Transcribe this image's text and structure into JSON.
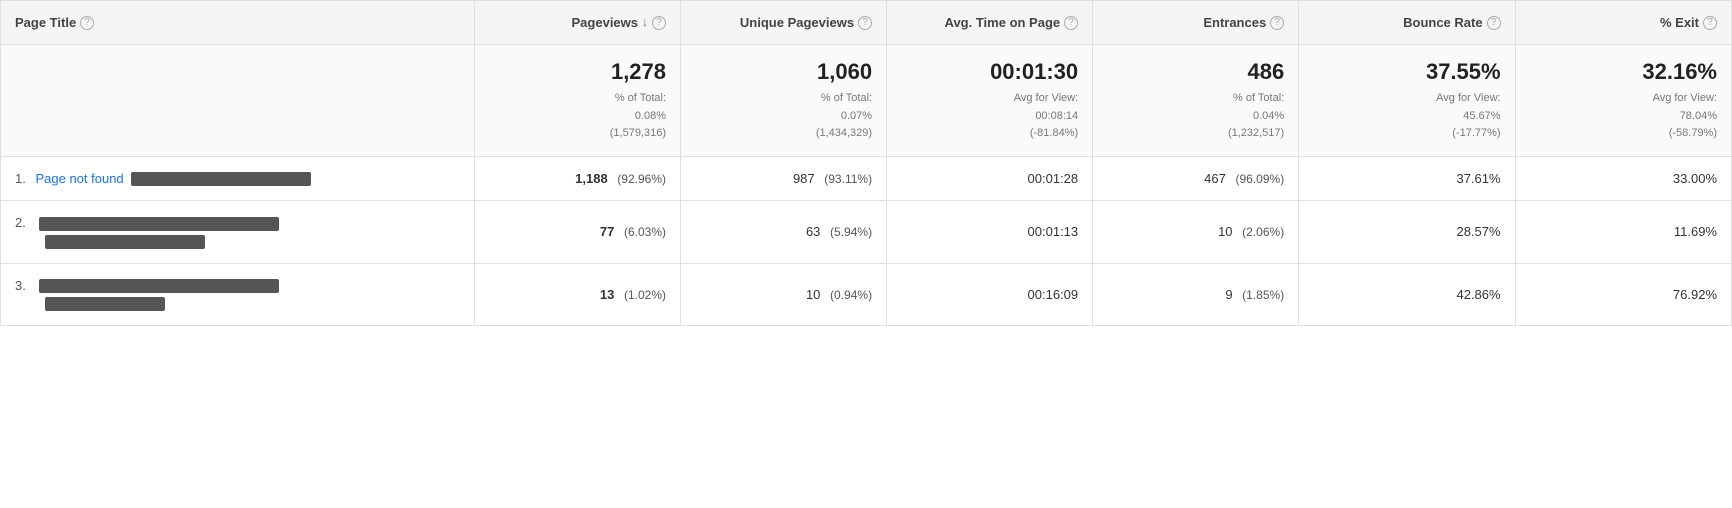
{
  "header": {
    "page_title_label": "Page Title",
    "pageviews_label": "Pageviews",
    "unique_pageviews_label": "Unique Pageviews",
    "avg_time_label": "Avg. Time on Page",
    "entrances_label": "Entrances",
    "bounce_rate_label": "Bounce Rate",
    "exit_label": "% Exit"
  },
  "summary": {
    "pageviews_main": "1,278",
    "pageviews_sub": "% of Total:\n0.08%\n(1,579,316)",
    "unique_pageviews_main": "1,060",
    "unique_pageviews_sub": "% of Total:\n0.07%\n(1,434,329)",
    "avg_time_main": "00:01:30",
    "avg_time_sub": "Avg for View:\n00:08:14\n(-81.84%)",
    "entrances_main": "486",
    "entrances_sub": "% of Total:\n0.04%\n(1,232,517)",
    "bounce_rate_main": "37.55%",
    "bounce_rate_sub": "Avg for View:\n45.67%\n(-17.77%)",
    "exit_main": "32.16%",
    "exit_sub": "Avg for View:\n78.04%\n(-58.79%)"
  },
  "rows": [
    {
      "num": "1.",
      "title": "Page not found",
      "redacted_w1": 180,
      "redacted_w2": null,
      "pageviews_main": "1,188",
      "pageviews_pct": "(92.96%)",
      "unique_main": "987",
      "unique_pct": "(93.11%)",
      "avg_time": "00:01:28",
      "entrances_main": "467",
      "entrances_pct": "(96.09%)",
      "bounce_rate": "37.61%",
      "exit": "33.00%"
    },
    {
      "num": "2.",
      "title": "",
      "redacted_w1": 240,
      "redacted_w2": 160,
      "pageviews_main": "77",
      "pageviews_pct": "(6.03%)",
      "unique_main": "63",
      "unique_pct": "(5.94%)",
      "avg_time": "00:01:13",
      "entrances_main": "10",
      "entrances_pct": "(2.06%)",
      "bounce_rate": "28.57%",
      "exit": "11.69%"
    },
    {
      "num": "3.",
      "title": "",
      "redacted_w1": 240,
      "redacted_w2": 120,
      "pageviews_main": "13",
      "pageviews_pct": "(1.02%)",
      "unique_main": "10",
      "unique_pct": "(0.94%)",
      "avg_time": "00:16:09",
      "entrances_main": "9",
      "entrances_pct": "(1.85%)",
      "bounce_rate": "42.86%",
      "exit": "76.92%"
    }
  ]
}
